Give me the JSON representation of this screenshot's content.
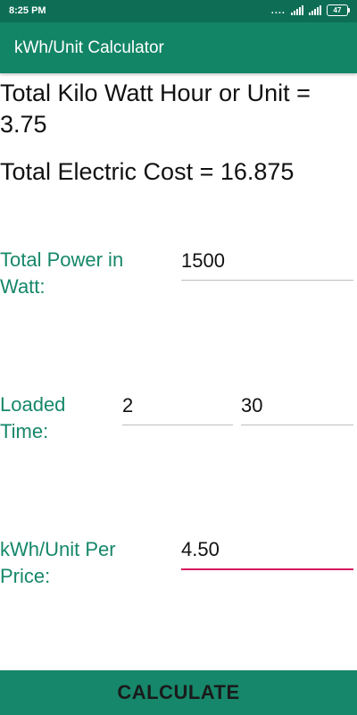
{
  "status_bar": {
    "time": "8:25 PM",
    "dots": "....",
    "battery": "47"
  },
  "app_bar": {
    "title": "kWh/Unit Calculator"
  },
  "results": {
    "total_unit": "Total Kilo Watt Hour or Unit = 3.75",
    "total_cost": "Total Electric Cost = 16.875"
  },
  "form": {
    "power_label": "Total Power in Watt:",
    "power_value": "1500",
    "time_label": "Loaded Time:",
    "hours_value": "2",
    "minutes_value": "30",
    "price_label": "kWh/Unit Per Price:",
    "price_value": "4.50"
  },
  "actions": {
    "calculate_label": "CALCULATE"
  },
  "colors": {
    "status_bar": "#0d6e55",
    "app_bar": "#128566",
    "accent_label": "#16876a",
    "focus_underline": "#d81b60"
  }
}
